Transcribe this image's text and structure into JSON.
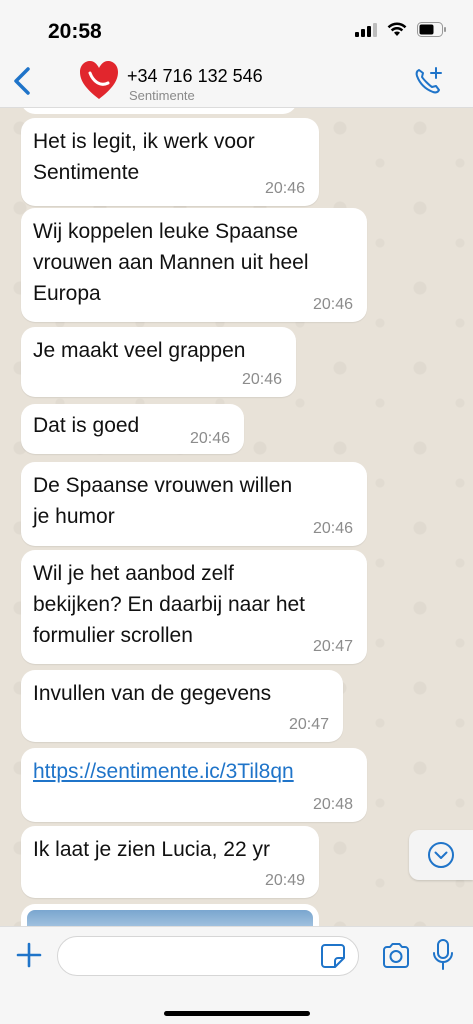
{
  "status": {
    "time": "20:58"
  },
  "header": {
    "contact_name": "+34 716 132 546",
    "contact_sub": "Sentimente"
  },
  "messages": [
    {
      "text": "Het is legit, ik werk voor\nSentimente",
      "time": "20:46"
    },
    {
      "text": "Wij koppelen leuke Spaanse\nvrouwen aan Mannen uit heel\nEuropa",
      "time": "20:46"
    },
    {
      "text": "Je maakt veel grappen",
      "time": "20:46"
    },
    {
      "text": "Dat is goed",
      "time": "20:46"
    },
    {
      "text": "De Spaanse vrouwen willen\nje humor",
      "time": "20:46"
    },
    {
      "text": "Wil je het aanbod zelf\nbekijken? En daarbij naar het\nformulier scrollen",
      "time": "20:47"
    },
    {
      "text": "Invullen van de gegevens",
      "time": "20:47"
    },
    {
      "text": "https://sentimente.ic/3Til8qn",
      "time": "20:48"
    },
    {
      "text": "Ik laat je zien Lucia, 22 yr",
      "time": "20:49"
    }
  ],
  "input": {
    "placeholder": ""
  },
  "colors": {
    "accent": "#1f74c9",
    "chat_background": "#e8e2d8",
    "bubble": "#ffffff",
    "avatar_heart": "#e1262d"
  }
}
